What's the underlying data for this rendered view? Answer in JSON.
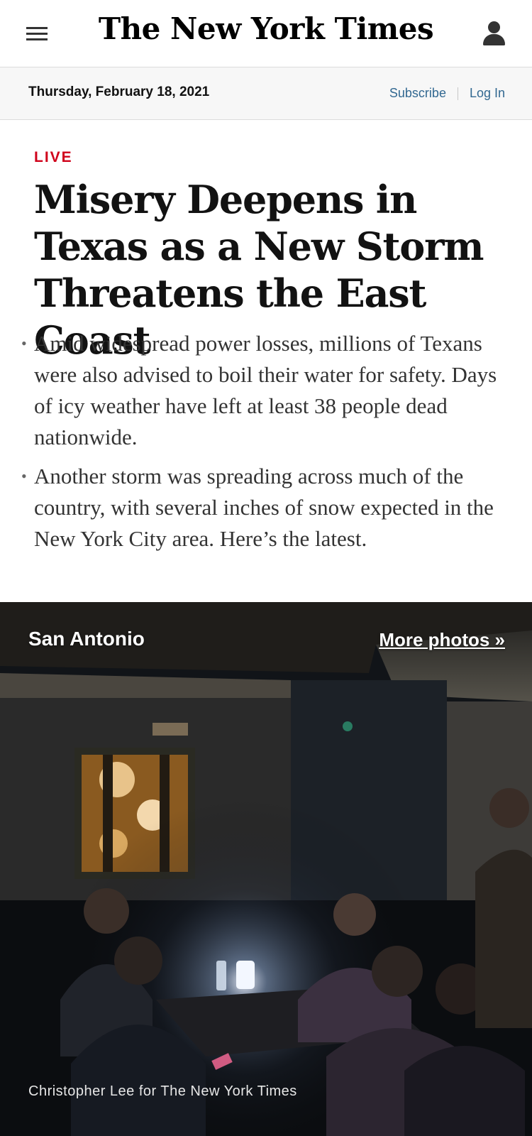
{
  "header": {
    "logo": "The New York Times",
    "menu_icon": "hamburger-menu-icon",
    "account_icon": "user-account-icon"
  },
  "datebar": {
    "date": "Thursday, February 18, 2021",
    "subscribe": "Subscribe",
    "login": "Log In"
  },
  "article": {
    "label": "LIVE",
    "headline": "Misery Deepens in Texas as a New Storm Threatens the East Coast",
    "bullets": [
      "Amid widespread power losses, millions of Texans were also advised to boil their water for safety. Days of icy weather have left at least 38 people dead nationwide.",
      "Another storm was spreading across much of the country, with several inches of snow expected in the New York City area. Here’s the latest."
    ]
  },
  "photo": {
    "location": "San Antonio",
    "more_link": "More photos »",
    "credit": "Christopher Lee for The New York Times"
  },
  "colors": {
    "live_red": "#d0021b",
    "link_blue": "#326891",
    "text": "#121212"
  }
}
